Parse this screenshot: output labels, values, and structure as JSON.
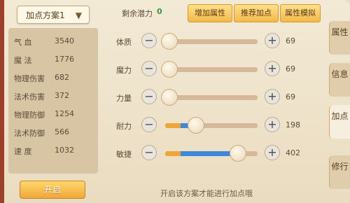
{
  "plan": {
    "label": "加点方案1"
  },
  "stats": [
    {
      "label": "气    血",
      "value": "3540"
    },
    {
      "label": "魔    法",
      "value": "1776"
    },
    {
      "label": "物理伤害",
      "value": "682"
    },
    {
      "label": "法术伤害",
      "value": "372"
    },
    {
      "label": "物理防御",
      "value": "1254"
    },
    {
      "label": "法术防御",
      "value": "566"
    },
    {
      "label": "速    度",
      "value": "1032"
    }
  ],
  "start_button": "开启",
  "potential": {
    "label": "剩余潜力",
    "value": "0"
  },
  "top_buttons": [
    "增加属性",
    "推荐加点",
    "属性模拟"
  ],
  "attributes": [
    {
      "label": "体质",
      "value": "69",
      "base_fraction": 0.0,
      "add_fraction": 0.0
    },
    {
      "label": "魔力",
      "value": "69",
      "base_fraction": 0.0,
      "add_fraction": 0.0
    },
    {
      "label": "力量",
      "value": "69",
      "base_fraction": 0.0,
      "add_fraction": 0.0
    },
    {
      "label": "耐力",
      "value": "198",
      "base_fraction": 0.17,
      "add_fraction": 0.12
    },
    {
      "label": "敏捷",
      "value": "402",
      "base_fraction": 0.17,
      "add_fraction": 0.57
    }
  ],
  "hint": "开启该方案才能进行加点哦",
  "tabs": [
    {
      "label": "属性",
      "active": false
    },
    {
      "label": "信息",
      "active": false
    },
    {
      "label": "加点",
      "active": true
    },
    {
      "label": "修行",
      "active": false
    }
  ],
  "colors": {
    "base_fill": "#f0a636",
    "add_fill": "#3f87d8",
    "potential": "#2f9c3b"
  }
}
